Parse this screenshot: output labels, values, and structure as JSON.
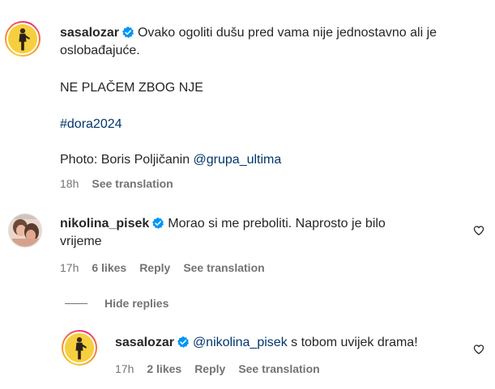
{
  "caption": {
    "username": "sasalozar",
    "line1": "Ovako ogoliti dušu pred vama nije jednostavno ali je",
    "line2": "oslobađajuće.",
    "line3": "NE PLAČEM ZBOG NJE",
    "hashtag": "#dora2024",
    "photo_prefix": "Photo: Boris Poljičanin ",
    "photo_mention": "@grupa_ultima",
    "time": "18h",
    "see_translation": "See translation"
  },
  "comment": {
    "username": "nikolina_pisek",
    "line1": "Morao si me preboliti. Naprosto je bilo",
    "line2": "vrijeme",
    "time": "17h",
    "likes": "6 likes",
    "reply": "Reply",
    "see_translation": "See translation"
  },
  "hide_replies": "Hide replies",
  "reply": {
    "username": "sasalozar",
    "mention": "@nikolina_pisek",
    "text": " s tobom uvijek drama!",
    "time": "17h",
    "likes": "2 likes",
    "reply": "Reply",
    "see_translation": "See translation"
  },
  "colors": {
    "verified": "#0095f6",
    "link": "#00376b",
    "muted": "#737373"
  }
}
